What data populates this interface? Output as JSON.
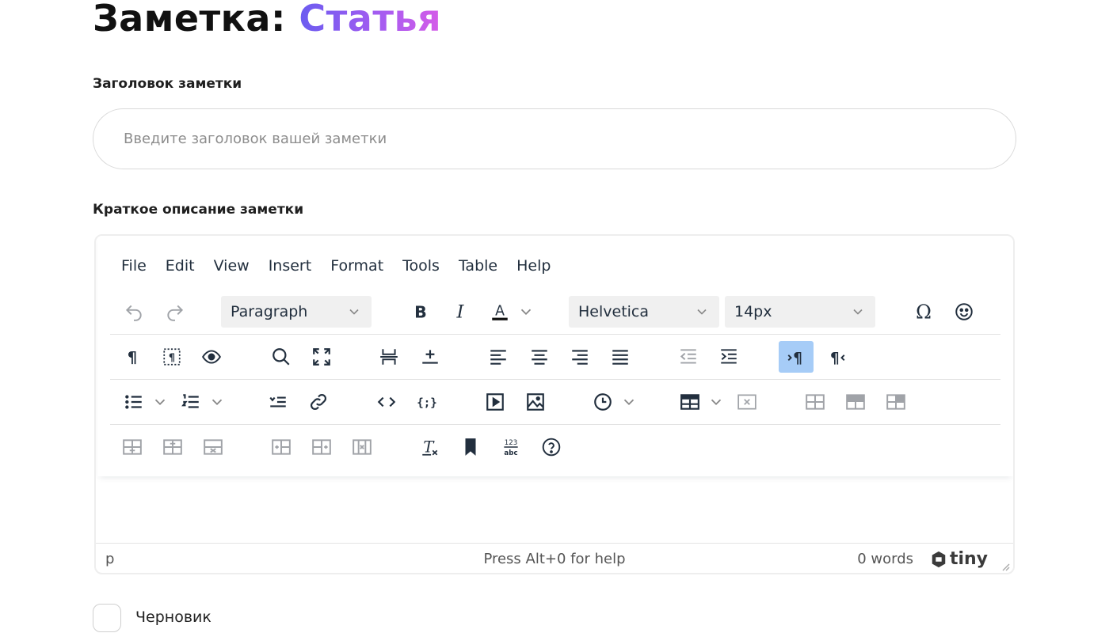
{
  "page": {
    "title_prefix": "Заметка:",
    "title_accent": "Статья"
  },
  "form": {
    "title_label": "Заголовок заметки",
    "title_placeholder": "Введите заголовок вашей заметки",
    "title_value": "",
    "description_label": "Краткое описание заметки",
    "draft_label": "Черновик",
    "draft_checked": false
  },
  "editor": {
    "menubar": [
      "File",
      "Edit",
      "View",
      "Insert",
      "Format",
      "Tools",
      "Table",
      "Help"
    ],
    "block_format": "Paragraph",
    "font_family": "Helvetica",
    "font_size": "14px",
    "statusbar": {
      "path": "p",
      "help": "Press Alt+0 for help",
      "word_count": "0 words",
      "brand": "tiny"
    },
    "icons": {
      "row1": [
        "undo-icon",
        "redo-icon",
        "bold-icon",
        "italic-icon",
        "text-color-icon",
        "special-character-icon",
        "emoji-icon"
      ],
      "row2": [
        "visual-chars-icon",
        "visual-blocks-icon",
        "preview-icon",
        "search-replace-icon",
        "fullscreen-icon",
        "page-break-icon",
        "horizontal-rule-icon",
        "align-left-icon",
        "align-center-icon",
        "align-right-icon",
        "align-justify-icon",
        "outdent-icon",
        "indent-icon",
        "ltr-icon",
        "rtl-icon"
      ],
      "row3": [
        "bullet-list-icon",
        "numbered-list-icon",
        "anchor-icon",
        "link-icon",
        "code-view-icon",
        "code-sample-icon",
        "media-icon",
        "image-icon",
        "insert-time-icon",
        "table-icon",
        "table-delete-icon",
        "table-row-props-icon",
        "table-cell-props-icon",
        "table-split-icon"
      ],
      "row4": [
        "table-insert-row-above-icon",
        "table-insert-row-after-icon",
        "table-delete-row-icon",
        "table-insert-col-before-icon",
        "table-insert-col-after-icon",
        "table-delete-col-icon",
        "remove-format-icon",
        "bookmark-icon",
        "word-count-icon",
        "help-icon"
      ]
    },
    "active_button": "ltr-icon"
  }
}
